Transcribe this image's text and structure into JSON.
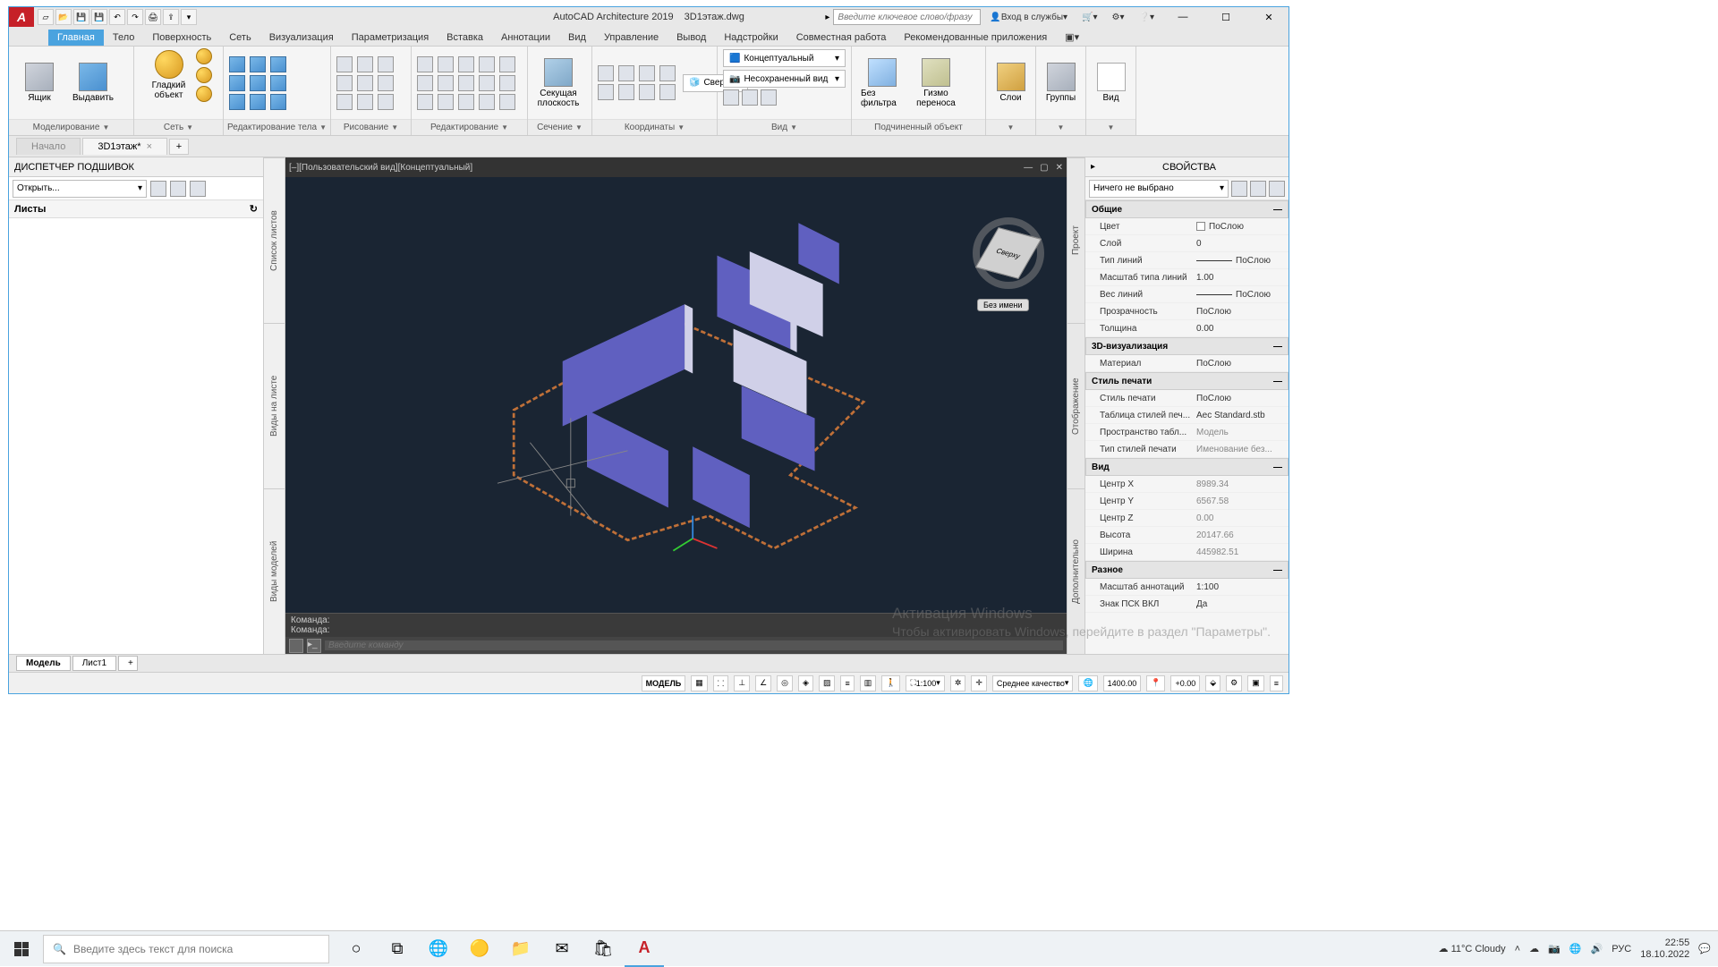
{
  "app": {
    "name": "AutoCAD Architecture 2019",
    "document": "3D1этаж.dwg",
    "icon_letter": "A"
  },
  "title_right": {
    "search_placeholder": "Введите ключевое слово/фразу",
    "signin": "Вход в службы"
  },
  "ribbon_tabs": [
    "Главная",
    "Тело",
    "Поверхность",
    "Сеть",
    "Визуализация",
    "Параметризация",
    "Вставка",
    "Аннотации",
    "Вид",
    "Управление",
    "Вывод",
    "Надстройки",
    "Совместная работа",
    "Рекомендованные приложения"
  ],
  "active_tab_index": 0,
  "panels": {
    "modeling": {
      "title": "Моделирование",
      "box": "Ящик",
      "extrude": "Выдавить",
      "smooth": "Гладкий объект"
    },
    "mesh": {
      "title": "Сеть"
    },
    "bodyedit": {
      "title": "Редактирование тела"
    },
    "draw": {
      "title": "Рисование"
    },
    "modify": {
      "title": "Редактирование"
    },
    "section": {
      "title": "Сечение",
      "btn": "Секущая плоскость"
    },
    "coords": {
      "title": "Координаты",
      "top": "Сверху"
    },
    "view": {
      "title": "Вид",
      "style": "Концептуальный",
      "saved": "Несохраненный вид"
    },
    "selection": {
      "title": "Подчиненный объект",
      "filter": "Без фильтра",
      "gizmo": "Гизмо переноса"
    },
    "layers": {
      "title": "Слои"
    },
    "groups": {
      "title": "Группы"
    },
    "viewp": {
      "title": "Вид"
    }
  },
  "file_tabs": {
    "start": "Начало",
    "doc": "3D1этаж*"
  },
  "sheet_manager": {
    "title": "ДИСПЕТЧЕР ПОДШИВОК",
    "open": "Открыть...",
    "sheets": "Листы",
    "vtabs": [
      "Список листов",
      "Виды на листе",
      "Виды моделей"
    ]
  },
  "viewport": {
    "label_left": "[–][Пользовательский вид][Концептуальный]",
    "navcube_top": "Сверху",
    "navcube_label": "Без имени"
  },
  "command": {
    "line1": "Команда:",
    "line2": "Команда:",
    "placeholder": "Введите команду"
  },
  "properties": {
    "title": "СВОЙСТВА",
    "nothing": "Ничего не выбрано",
    "vtabs": [
      "Проект",
      "Отображение",
      "Дополнительно"
    ],
    "groups": {
      "general": {
        "title": "Общие",
        "rows": [
          {
            "k": "Цвет",
            "v": "ПоСлою",
            "cb": true
          },
          {
            "k": "Слой",
            "v": "0"
          },
          {
            "k": "Тип линий",
            "v": "ПоСлою",
            "line": true
          },
          {
            "k": "Масштаб типа линий",
            "v": "1.00"
          },
          {
            "k": "Вес линий",
            "v": "ПоСлою",
            "line": true
          },
          {
            "k": "Прозрачность",
            "v": "ПоСлою"
          },
          {
            "k": "Толщина",
            "v": "0.00"
          }
        ]
      },
      "viz": {
        "title": "3D-визуализация",
        "rows": [
          {
            "k": "Материал",
            "v": "ПоСлою"
          }
        ]
      },
      "plot": {
        "title": "Стиль печати",
        "rows": [
          {
            "k": "Стиль печати",
            "v": "ПоСлою"
          },
          {
            "k": "Таблица стилей печ...",
            "v": "Aec Standard.stb"
          },
          {
            "k": "Пространство табл...",
            "v": "Модель",
            "ro": true
          },
          {
            "k": "Тип стилей печати",
            "v": "Именование без...",
            "ro": true
          }
        ]
      },
      "view": {
        "title": "Вид",
        "rows": [
          {
            "k": "Центр X",
            "v": "8989.34",
            "ro": true
          },
          {
            "k": "Центр Y",
            "v": "6567.58",
            "ro": true
          },
          {
            "k": "Центр Z",
            "v": "0.00",
            "ro": true
          },
          {
            "k": "Высота",
            "v": "20147.66",
            "ro": true
          },
          {
            "k": "Ширина",
            "v": "445982.51",
            "ro": true
          }
        ]
      },
      "misc": {
        "title": "Разное",
        "rows": [
          {
            "k": "Масштаб аннотаций",
            "v": "1:100"
          },
          {
            "k": "Знак ПСК ВКЛ",
            "v": "Да"
          }
        ]
      }
    }
  },
  "layout_tabs": {
    "model": "Модель",
    "layout1": "Лист1"
  },
  "status": {
    "model": "МОДЕЛЬ",
    "scale": "1:100",
    "quality": "Среднее качество",
    "num1": "1400.00",
    "num2": "+0.00"
  },
  "watermark": {
    "title": "Активация Windows",
    "sub": "Чтобы активировать Windows, перейдите в раздел \"Параметры\"."
  },
  "taskbar": {
    "search_placeholder": "Введите здесь текст для поиска",
    "weather": "11°C  Cloudy",
    "lang": "РУС",
    "time": "22:55",
    "date": "18.10.2022"
  }
}
